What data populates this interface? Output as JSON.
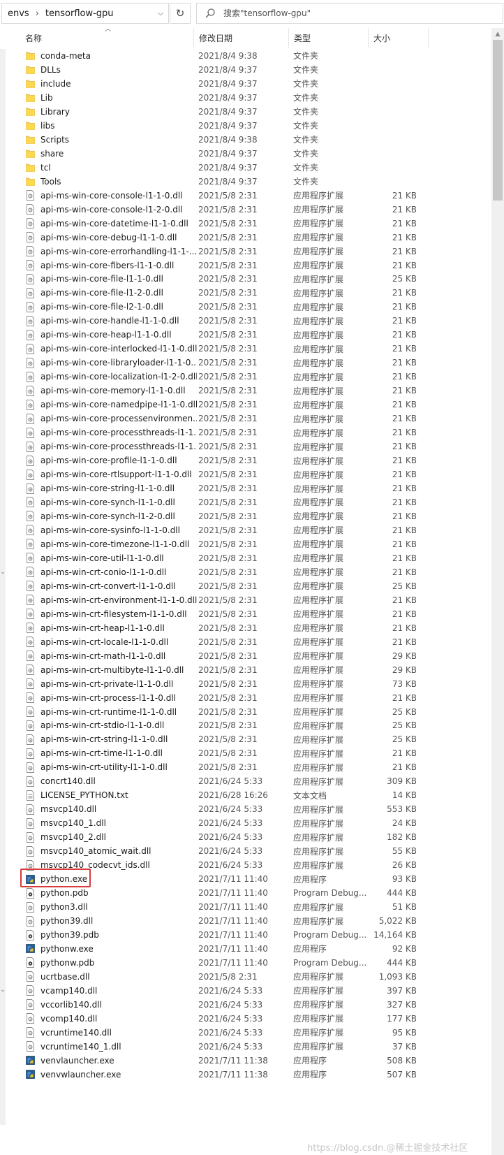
{
  "address": {
    "crumbs": [
      "envs",
      "tensorflow-gpu"
    ],
    "separator": "›",
    "dropdown": "⌵",
    "refresh": "↻"
  },
  "search": {
    "placeholder": "搜索\"tensorflow-gpu\""
  },
  "columns": {
    "name": "名称",
    "date": "修改日期",
    "type": "类型",
    "size": "大小"
  },
  "watermark": "https://blog.csdn.@稀土掘金技术社区",
  "files": [
    {
      "name": "conda-meta",
      "date": "2021/8/4 9:38",
      "type": "文件夹",
      "size": "",
      "icon": "folder"
    },
    {
      "name": "DLLs",
      "date": "2021/8/4 9:37",
      "type": "文件夹",
      "size": "",
      "icon": "folder"
    },
    {
      "name": "include",
      "date": "2021/8/4 9:37",
      "type": "文件夹",
      "size": "",
      "icon": "folder"
    },
    {
      "name": "Lib",
      "date": "2021/8/4 9:37",
      "type": "文件夹",
      "size": "",
      "icon": "folder"
    },
    {
      "name": "Library",
      "date": "2021/8/4 9:37",
      "type": "文件夹",
      "size": "",
      "icon": "folder"
    },
    {
      "name": "libs",
      "date": "2021/8/4 9:37",
      "type": "文件夹",
      "size": "",
      "icon": "folder"
    },
    {
      "name": "Scripts",
      "date": "2021/8/4 9:38",
      "type": "文件夹",
      "size": "",
      "icon": "folder"
    },
    {
      "name": "share",
      "date": "2021/8/4 9:37",
      "type": "文件夹",
      "size": "",
      "icon": "folder"
    },
    {
      "name": "tcl",
      "date": "2021/8/4 9:37",
      "type": "文件夹",
      "size": "",
      "icon": "folder"
    },
    {
      "name": "Tools",
      "date": "2021/8/4 9:37",
      "type": "文件夹",
      "size": "",
      "icon": "folder"
    },
    {
      "name": "api-ms-win-core-console-l1-1-0.dll",
      "date": "2021/5/8 2:31",
      "type": "应用程序扩展",
      "size": "21 KB",
      "icon": "dll"
    },
    {
      "name": "api-ms-win-core-console-l1-2-0.dll",
      "date": "2021/5/8 2:31",
      "type": "应用程序扩展",
      "size": "21 KB",
      "icon": "dll"
    },
    {
      "name": "api-ms-win-core-datetime-l1-1-0.dll",
      "date": "2021/5/8 2:31",
      "type": "应用程序扩展",
      "size": "21 KB",
      "icon": "dll"
    },
    {
      "name": "api-ms-win-core-debug-l1-1-0.dll",
      "date": "2021/5/8 2:31",
      "type": "应用程序扩展",
      "size": "21 KB",
      "icon": "dll"
    },
    {
      "name": "api-ms-win-core-errorhandling-l1-1-...",
      "date": "2021/5/8 2:31",
      "type": "应用程序扩展",
      "size": "21 KB",
      "icon": "dll"
    },
    {
      "name": "api-ms-win-core-fibers-l1-1-0.dll",
      "date": "2021/5/8 2:31",
      "type": "应用程序扩展",
      "size": "21 KB",
      "icon": "dll"
    },
    {
      "name": "api-ms-win-core-file-l1-1-0.dll",
      "date": "2021/5/8 2:31",
      "type": "应用程序扩展",
      "size": "25 KB",
      "icon": "dll"
    },
    {
      "name": "api-ms-win-core-file-l1-2-0.dll",
      "date": "2021/5/8 2:31",
      "type": "应用程序扩展",
      "size": "21 KB",
      "icon": "dll"
    },
    {
      "name": "api-ms-win-core-file-l2-1-0.dll",
      "date": "2021/5/8 2:31",
      "type": "应用程序扩展",
      "size": "21 KB",
      "icon": "dll"
    },
    {
      "name": "api-ms-win-core-handle-l1-1-0.dll",
      "date": "2021/5/8 2:31",
      "type": "应用程序扩展",
      "size": "21 KB",
      "icon": "dll"
    },
    {
      "name": "api-ms-win-core-heap-l1-1-0.dll",
      "date": "2021/5/8 2:31",
      "type": "应用程序扩展",
      "size": "21 KB",
      "icon": "dll"
    },
    {
      "name": "api-ms-win-core-interlocked-l1-1-0.dll",
      "date": "2021/5/8 2:31",
      "type": "应用程序扩展",
      "size": "21 KB",
      "icon": "dll"
    },
    {
      "name": "api-ms-win-core-libraryloader-l1-1-0....",
      "date": "2021/5/8 2:31",
      "type": "应用程序扩展",
      "size": "21 KB",
      "icon": "dll"
    },
    {
      "name": "api-ms-win-core-localization-l1-2-0.dll",
      "date": "2021/5/8 2:31",
      "type": "应用程序扩展",
      "size": "21 KB",
      "icon": "dll"
    },
    {
      "name": "api-ms-win-core-memory-l1-1-0.dll",
      "date": "2021/5/8 2:31",
      "type": "应用程序扩展",
      "size": "21 KB",
      "icon": "dll"
    },
    {
      "name": "api-ms-win-core-namedpipe-l1-1-0.dll",
      "date": "2021/5/8 2:31",
      "type": "应用程序扩展",
      "size": "21 KB",
      "icon": "dll"
    },
    {
      "name": "api-ms-win-core-processenvironmen...",
      "date": "2021/5/8 2:31",
      "type": "应用程序扩展",
      "size": "21 KB",
      "icon": "dll"
    },
    {
      "name": "api-ms-win-core-processthreads-l1-1...",
      "date": "2021/5/8 2:31",
      "type": "应用程序扩展",
      "size": "21 KB",
      "icon": "dll"
    },
    {
      "name": "api-ms-win-core-processthreads-l1-1...",
      "date": "2021/5/8 2:31",
      "type": "应用程序扩展",
      "size": "21 KB",
      "icon": "dll"
    },
    {
      "name": "api-ms-win-core-profile-l1-1-0.dll",
      "date": "2021/5/8 2:31",
      "type": "应用程序扩展",
      "size": "21 KB",
      "icon": "dll"
    },
    {
      "name": "api-ms-win-core-rtlsupport-l1-1-0.dll",
      "date": "2021/5/8 2:31",
      "type": "应用程序扩展",
      "size": "21 KB",
      "icon": "dll"
    },
    {
      "name": "api-ms-win-core-string-l1-1-0.dll",
      "date": "2021/5/8 2:31",
      "type": "应用程序扩展",
      "size": "21 KB",
      "icon": "dll"
    },
    {
      "name": "api-ms-win-core-synch-l1-1-0.dll",
      "date": "2021/5/8 2:31",
      "type": "应用程序扩展",
      "size": "21 KB",
      "icon": "dll"
    },
    {
      "name": "api-ms-win-core-synch-l1-2-0.dll",
      "date": "2021/5/8 2:31",
      "type": "应用程序扩展",
      "size": "21 KB",
      "icon": "dll"
    },
    {
      "name": "api-ms-win-core-sysinfo-l1-1-0.dll",
      "date": "2021/5/8 2:31",
      "type": "应用程序扩展",
      "size": "21 KB",
      "icon": "dll"
    },
    {
      "name": "api-ms-win-core-timezone-l1-1-0.dll",
      "date": "2021/5/8 2:31",
      "type": "应用程序扩展",
      "size": "21 KB",
      "icon": "dll"
    },
    {
      "name": "api-ms-win-core-util-l1-1-0.dll",
      "date": "2021/5/8 2:31",
      "type": "应用程序扩展",
      "size": "21 KB",
      "icon": "dll"
    },
    {
      "name": "api-ms-win-crt-conio-l1-1-0.dll",
      "date": "2021/5/8 2:31",
      "type": "应用程序扩展",
      "size": "21 KB",
      "icon": "dll"
    },
    {
      "name": "api-ms-win-crt-convert-l1-1-0.dll",
      "date": "2021/5/8 2:31",
      "type": "应用程序扩展",
      "size": "25 KB",
      "icon": "dll"
    },
    {
      "name": "api-ms-win-crt-environment-l1-1-0.dll",
      "date": "2021/5/8 2:31",
      "type": "应用程序扩展",
      "size": "21 KB",
      "icon": "dll"
    },
    {
      "name": "api-ms-win-crt-filesystem-l1-1-0.dll",
      "date": "2021/5/8 2:31",
      "type": "应用程序扩展",
      "size": "21 KB",
      "icon": "dll"
    },
    {
      "name": "api-ms-win-crt-heap-l1-1-0.dll",
      "date": "2021/5/8 2:31",
      "type": "应用程序扩展",
      "size": "21 KB",
      "icon": "dll"
    },
    {
      "name": "api-ms-win-crt-locale-l1-1-0.dll",
      "date": "2021/5/8 2:31",
      "type": "应用程序扩展",
      "size": "21 KB",
      "icon": "dll"
    },
    {
      "name": "api-ms-win-crt-math-l1-1-0.dll",
      "date": "2021/5/8 2:31",
      "type": "应用程序扩展",
      "size": "29 KB",
      "icon": "dll"
    },
    {
      "name": "api-ms-win-crt-multibyte-l1-1-0.dll",
      "date": "2021/5/8 2:31",
      "type": "应用程序扩展",
      "size": "29 KB",
      "icon": "dll"
    },
    {
      "name": "api-ms-win-crt-private-l1-1-0.dll",
      "date": "2021/5/8 2:31",
      "type": "应用程序扩展",
      "size": "73 KB",
      "icon": "dll"
    },
    {
      "name": "api-ms-win-crt-process-l1-1-0.dll",
      "date": "2021/5/8 2:31",
      "type": "应用程序扩展",
      "size": "21 KB",
      "icon": "dll"
    },
    {
      "name": "api-ms-win-crt-runtime-l1-1-0.dll",
      "date": "2021/5/8 2:31",
      "type": "应用程序扩展",
      "size": "25 KB",
      "icon": "dll"
    },
    {
      "name": "api-ms-win-crt-stdio-l1-1-0.dll",
      "date": "2021/5/8 2:31",
      "type": "应用程序扩展",
      "size": "25 KB",
      "icon": "dll"
    },
    {
      "name": "api-ms-win-crt-string-l1-1-0.dll",
      "date": "2021/5/8 2:31",
      "type": "应用程序扩展",
      "size": "25 KB",
      "icon": "dll"
    },
    {
      "name": "api-ms-win-crt-time-l1-1-0.dll",
      "date": "2021/5/8 2:31",
      "type": "应用程序扩展",
      "size": "21 KB",
      "icon": "dll"
    },
    {
      "name": "api-ms-win-crt-utility-l1-1-0.dll",
      "date": "2021/5/8 2:31",
      "type": "应用程序扩展",
      "size": "21 KB",
      "icon": "dll"
    },
    {
      "name": "concrt140.dll",
      "date": "2021/6/24 5:33",
      "type": "应用程序扩展",
      "size": "309 KB",
      "icon": "dll"
    },
    {
      "name": "LICENSE_PYTHON.txt",
      "date": "2021/6/28 16:26",
      "type": "文本文档",
      "size": "14 KB",
      "icon": "txt"
    },
    {
      "name": "msvcp140.dll",
      "date": "2021/6/24 5:33",
      "type": "应用程序扩展",
      "size": "553 KB",
      "icon": "dll"
    },
    {
      "name": "msvcp140_1.dll",
      "date": "2021/6/24 5:33",
      "type": "应用程序扩展",
      "size": "24 KB",
      "icon": "dll"
    },
    {
      "name": "msvcp140_2.dll",
      "date": "2021/6/24 5:33",
      "type": "应用程序扩展",
      "size": "182 KB",
      "icon": "dll"
    },
    {
      "name": "msvcp140_atomic_wait.dll",
      "date": "2021/6/24 5:33",
      "type": "应用程序扩展",
      "size": "55 KB",
      "icon": "dll"
    },
    {
      "name": "msvcp140_codecvt_ids.dll",
      "date": "2021/6/24 5:33",
      "type": "应用程序扩展",
      "size": "26 KB",
      "icon": "dll"
    },
    {
      "name": "python.exe",
      "date": "2021/7/11 11:40",
      "type": "应用程序",
      "size": "93 KB",
      "icon": "exe"
    },
    {
      "name": "python.pdb",
      "date": "2021/7/11 11:40",
      "type": "Program Debug...",
      "size": "444 KB",
      "icon": "pdb"
    },
    {
      "name": "python3.dll",
      "date": "2021/7/11 11:40",
      "type": "应用程序扩展",
      "size": "51 KB",
      "icon": "dll"
    },
    {
      "name": "python39.dll",
      "date": "2021/7/11 11:40",
      "type": "应用程序扩展",
      "size": "5,022 KB",
      "icon": "dll"
    },
    {
      "name": "python39.pdb",
      "date": "2021/7/11 11:40",
      "type": "Program Debug...",
      "size": "14,164 KB",
      "icon": "pdb"
    },
    {
      "name": "pythonw.exe",
      "date": "2021/7/11 11:40",
      "type": "应用程序",
      "size": "92 KB",
      "icon": "exe"
    },
    {
      "name": "pythonw.pdb",
      "date": "2021/7/11 11:40",
      "type": "Program Debug...",
      "size": "444 KB",
      "icon": "pdb"
    },
    {
      "name": "ucrtbase.dll",
      "date": "2021/5/8 2:31",
      "type": "应用程序扩展",
      "size": "1,093 KB",
      "icon": "dll"
    },
    {
      "name": "vcamp140.dll",
      "date": "2021/6/24 5:33",
      "type": "应用程序扩展",
      "size": "397 KB",
      "icon": "dll"
    },
    {
      "name": "vccorlib140.dll",
      "date": "2021/6/24 5:33",
      "type": "应用程序扩展",
      "size": "327 KB",
      "icon": "dll"
    },
    {
      "name": "vcomp140.dll",
      "date": "2021/6/24 5:33",
      "type": "应用程序扩展",
      "size": "177 KB",
      "icon": "dll"
    },
    {
      "name": "vcruntime140.dll",
      "date": "2021/6/24 5:33",
      "type": "应用程序扩展",
      "size": "95 KB",
      "icon": "dll"
    },
    {
      "name": "vcruntime140_1.dll",
      "date": "2021/6/24 5:33",
      "type": "应用程序扩展",
      "size": "37 KB",
      "icon": "dll"
    },
    {
      "name": "venvlauncher.exe",
      "date": "2021/7/11 11:38",
      "type": "应用程序",
      "size": "508 KB",
      "icon": "exe"
    },
    {
      "name": "venvwlauncher.exe",
      "date": "2021/7/11 11:38",
      "type": "应用程序",
      "size": "507 KB",
      "icon": "exe"
    }
  ]
}
